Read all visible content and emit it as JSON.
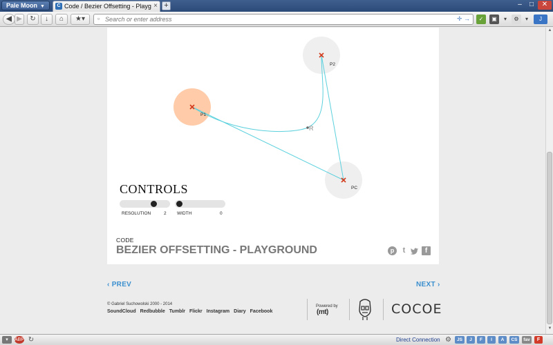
{
  "browser": {
    "app_menu_label": "Pale Moon",
    "tab_title": "Code / Bezier Offsetting - Playground...",
    "tab_favicon_text": "C",
    "new_tab_symbol": "+",
    "tab_close_symbol": "×",
    "url_placeholder": "Search or enter address",
    "url_actions": "✛ →",
    "status_text": "Direct Connection",
    "status_badges": [
      "JS",
      "J",
      "F",
      "I",
      "A",
      "CS",
      "fav"
    ]
  },
  "canvas": {
    "points": [
      {
        "label": "P1",
        "highlighted": true
      },
      {
        "label": "P2",
        "highlighted": false
      },
      {
        "label": "PC",
        "highlighted": false
      }
    ],
    "curve_point_label": "R",
    "colors": {
      "line": "#5ad0dd",
      "marker": "#d33a1c",
      "highlight": "#ffcba8",
      "handle": "#efefef"
    }
  },
  "controls": {
    "title": "CONTROLS",
    "resolution": {
      "label": "RESOLUTION",
      "value": "2",
      "level": 0.67
    },
    "width": {
      "label": "WIDTH",
      "value": "0",
      "level": 0.0
    }
  },
  "article": {
    "category": "CODE",
    "title": "BEZIER OFFSETTING - PLAYGROUND"
  },
  "social": {
    "pinterest": "p",
    "tumblr": "t",
    "twitter": "🐦",
    "facebook": "f"
  },
  "nav": {
    "prev": "‹ PREV",
    "next": "NEXT ›"
  },
  "footer": {
    "copyright": "© Gabriel Suchowolski 2000 - 2014",
    "links": [
      "SoundCloud",
      "Redbubble",
      "Tumblr",
      "Flickr",
      "Instagram",
      "Diary",
      "Facebook"
    ],
    "powered_by": "Powered by",
    "powered_logo": "(mt)",
    "brand_logo": "COCOE"
  }
}
